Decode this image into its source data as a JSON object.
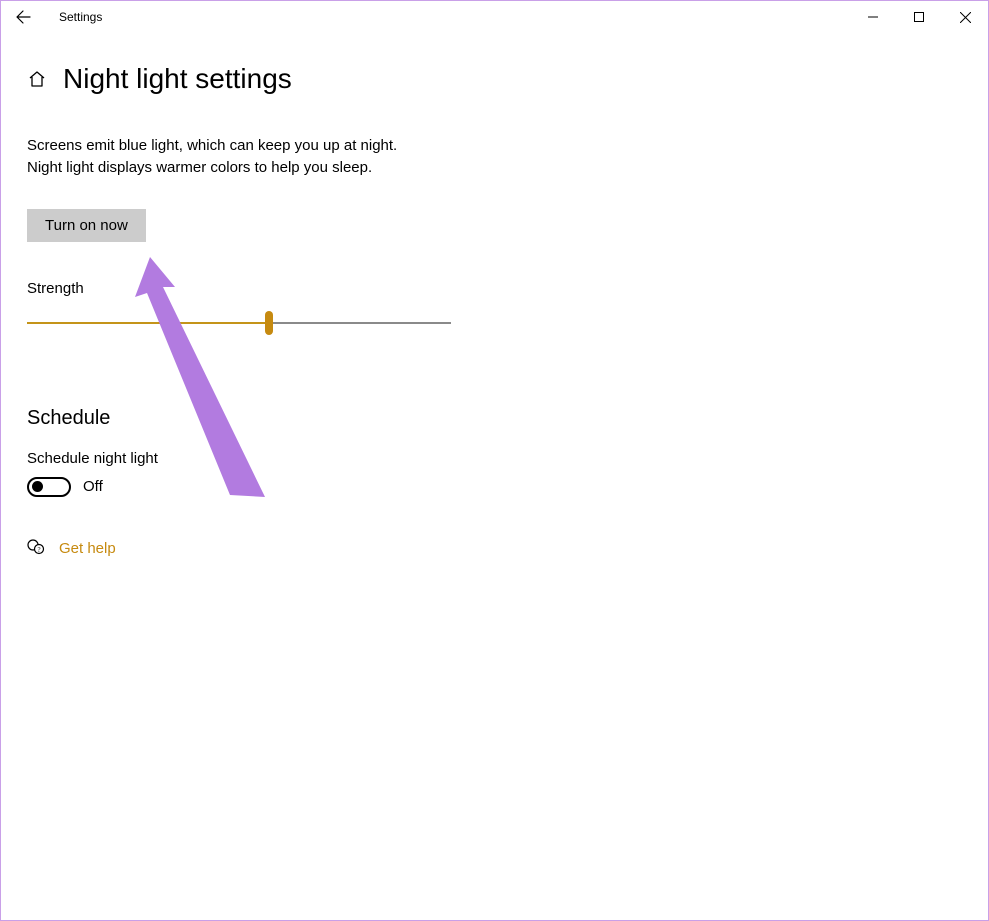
{
  "window": {
    "app_title": "Settings"
  },
  "page": {
    "title": "Night light settings",
    "description_line1": "Screens emit blue light, which can keep you up at night.",
    "description_line2": "Night light displays warmer colors to help you sleep.",
    "turn_on_label": "Turn on now",
    "strength_label": "Strength",
    "strength_value_percent": 57,
    "schedule_heading": "Schedule",
    "schedule_toggle_label": "Schedule night light",
    "schedule_toggle_state": "Off",
    "help_link": "Get help"
  },
  "colors": {
    "accent": "#c68a10",
    "button_bg": "#cccccc",
    "annotation": "#b27be0"
  }
}
